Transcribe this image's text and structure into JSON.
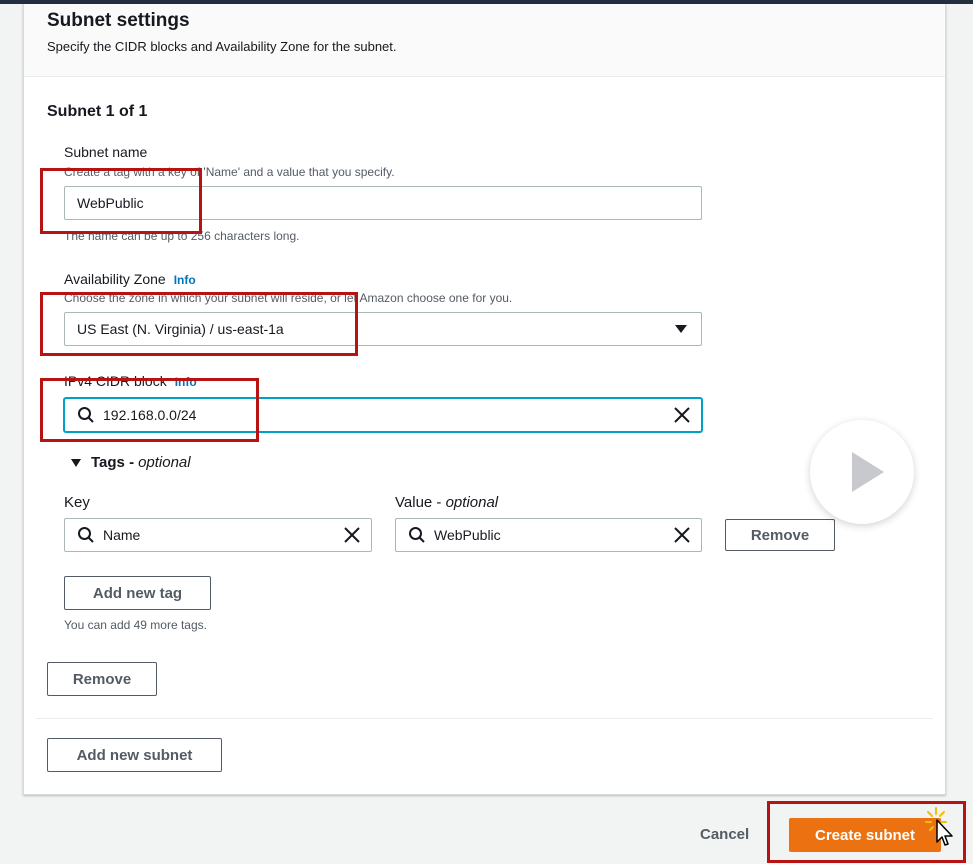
{
  "section": {
    "title": "Subnet settings",
    "description": "Specify the CIDR blocks and Availability Zone for the subnet."
  },
  "subnet": {
    "title": "Subnet 1 of 1",
    "name": {
      "label": "Subnet name",
      "description": "Create a tag with a key of 'Name' and a value that you specify.",
      "value": "WebPublic",
      "constraint": "The name can be up to 256 characters long."
    },
    "az": {
      "label": "Availability Zone",
      "info": "Info",
      "description": "Choose the zone in which your subnet will reside, or let Amazon choose one for you.",
      "value": "US East (N. Virginia) / us-east-1a"
    },
    "cidr": {
      "label": "IPv4 CIDR block",
      "info": "Info",
      "value": "192.168.0.0/24"
    },
    "tags": {
      "toggle_label": "Tags -",
      "toggle_optional": "optional",
      "key_label": "Key",
      "value_label": "Value -",
      "value_optional": "optional",
      "rows": [
        {
          "key": "Name",
          "value": "WebPublic",
          "remove_label": "Remove"
        }
      ],
      "add_label": "Add new tag",
      "remaining": "You can add 49 more tags."
    },
    "remove_label": "Remove"
  },
  "add_subnet_label": "Add new subnet",
  "footer": {
    "cancel_label": "Cancel",
    "create_label": "Create subnet"
  },
  "colors": {
    "primary": "#ec7211",
    "info_link": "#0073bb",
    "highlight": "#b81313",
    "focus": "#00a1c9"
  }
}
